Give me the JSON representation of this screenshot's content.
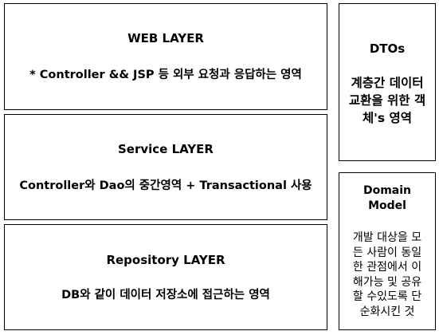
{
  "layers": {
    "web": {
      "title": "WEB LAYER",
      "description": "* Controller && JSP 등 외부 요청과 응답하는 영역"
    },
    "service": {
      "title": "Service LAYER",
      "description": "Controller와 Dao의 중간영역 + Transactional 사용"
    },
    "repository": {
      "title": "Repository LAYER",
      "description": "DB와 같이 데이터 저장소에 접근하는 영역"
    }
  },
  "dtos": {
    "title": "DTOs",
    "description_lines": [
      "계층간 데이터",
      "교환을 위한 객",
      "체's 영역"
    ]
  },
  "domain_model": {
    "title_lines": [
      "Domain",
      "Model"
    ],
    "description_lines": [
      "개발 대상을 모",
      "든 사람이 동일",
      "한 관점에서 이",
      "해가능 및 공유",
      "할 수있도록 단",
      "순화시킨 것"
    ]
  }
}
